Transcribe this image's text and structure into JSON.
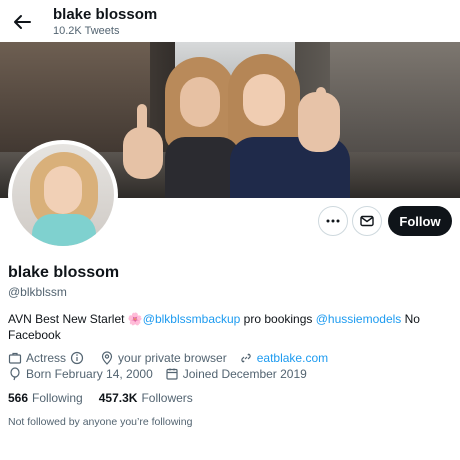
{
  "header": {
    "title": "blake blossom",
    "tweet_count": "10.2K Tweets",
    "back_icon": "arrow-left-icon"
  },
  "profile": {
    "display_name": "blake blossom",
    "handle": "@blkblssm",
    "bio": {
      "text1": "AVN Best New Starlet ",
      "emoji": "🌸",
      "mention1": "@blkblssmbackup",
      "text2": " pro bookings ",
      "mention2": "@hussiemodels",
      "text3": " No Facebook"
    },
    "meta": {
      "occupation": "Actress",
      "location": "your private browser",
      "website": "eatblake.com",
      "birthday": "Born February 14, 2000",
      "joined": "Joined December 2019"
    },
    "following_count": "566",
    "following_label": "Following",
    "followers_count": "457.3K",
    "followers_label": "Followers",
    "followed_by_note": "Not followed by anyone you’re following"
  },
  "actions": {
    "more_icon": "more-icon",
    "mail_icon": "mail-icon",
    "follow_label": "Follow"
  },
  "colors": {
    "accent": "#1d9bf0",
    "text": "#0f1419",
    "secondary": "#536471",
    "follow_bg": "#0f1419"
  }
}
